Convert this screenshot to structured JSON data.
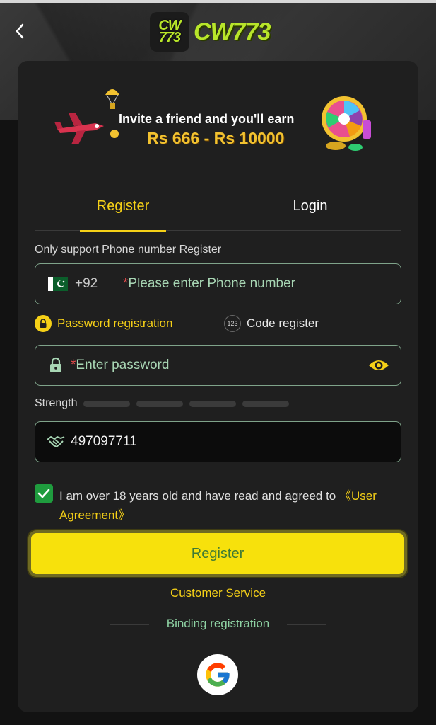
{
  "header": {
    "logo_badge": "CW\n773",
    "logo_text": "CW773"
  },
  "banner": {
    "line1": "Invite a friend and you'll earn",
    "line2": "Rs 666 - Rs 10000"
  },
  "tabs": {
    "register": "Register",
    "login": "Login"
  },
  "form": {
    "support_note": "Only support Phone number Register",
    "country_code": "+92",
    "phone_placeholder_star": "*",
    "phone_placeholder": "Please enter Phone number",
    "password_mode_label": "Password registration",
    "code_mode_badge": "123",
    "code_mode_label": "Code register",
    "password_placeholder_star": "*",
    "password_placeholder": "Enter password",
    "strength_label": "Strength",
    "invite_code": "497097711",
    "agree_text": "I am over 18 years old and have read and agreed to ",
    "agree_link": "《User Agreement》",
    "agree_checked": true
  },
  "actions": {
    "register_button": "Register",
    "customer_service": "Customer Service",
    "binding_registration": "Binding registration"
  },
  "colors": {
    "accent_yellow": "#f5d017",
    "field_border": "#7fa38a",
    "check_green": "#1f9c3e",
    "card_bg": "#1f1f1f"
  }
}
